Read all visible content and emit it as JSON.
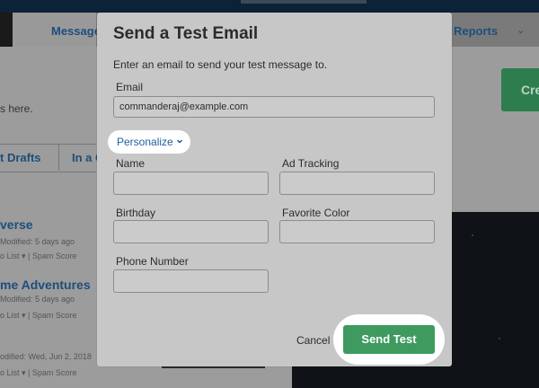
{
  "background": {
    "nav": {
      "messages": "Messages",
      "reports": "Reports"
    },
    "left_text": "s here.",
    "tabs": [
      "t Drafts",
      "In a C"
    ],
    "items": [
      {
        "title": "verse",
        "meta": "Modified: 5 days ago",
        "list": "o List ▾ | Spam Score"
      },
      {
        "title": "me Adventures",
        "meta": "Modified: 5 days ago",
        "list": "o List ▾ | Spam Score"
      },
      {
        "title": "",
        "meta": "odified: Wed, Jun 2, 2018",
        "list": "o List ▾ | Spam Score"
      }
    ],
    "create_label": "Cre"
  },
  "modal": {
    "title": "Send a Test Email",
    "subtitle": "Enter an email to send your test message to.",
    "email": {
      "label": "Email",
      "value": "commanderaj@example.com"
    },
    "personalize_label": "Personalize",
    "fields": {
      "name": {
        "label": "Name",
        "value": ""
      },
      "ad_tracking": {
        "label": "Ad Tracking",
        "value": ""
      },
      "birthday": {
        "label": "Birthday",
        "value": ""
      },
      "favorite_color": {
        "label": "Favorite Color",
        "value": ""
      },
      "phone_number": {
        "label": "Phone Number",
        "value": ""
      }
    },
    "cancel_label": "Cancel",
    "send_label": "Send Test"
  },
  "colors": {
    "overlay": "#9c9c9c",
    "modal_bg": "#c7c7c7",
    "link_blue": "#1c5f9e",
    "send_green": "#3e9a5f",
    "top_bar": "#0c2237"
  },
  "icons": {
    "personalize_toggle": "chevron-down-icon"
  }
}
